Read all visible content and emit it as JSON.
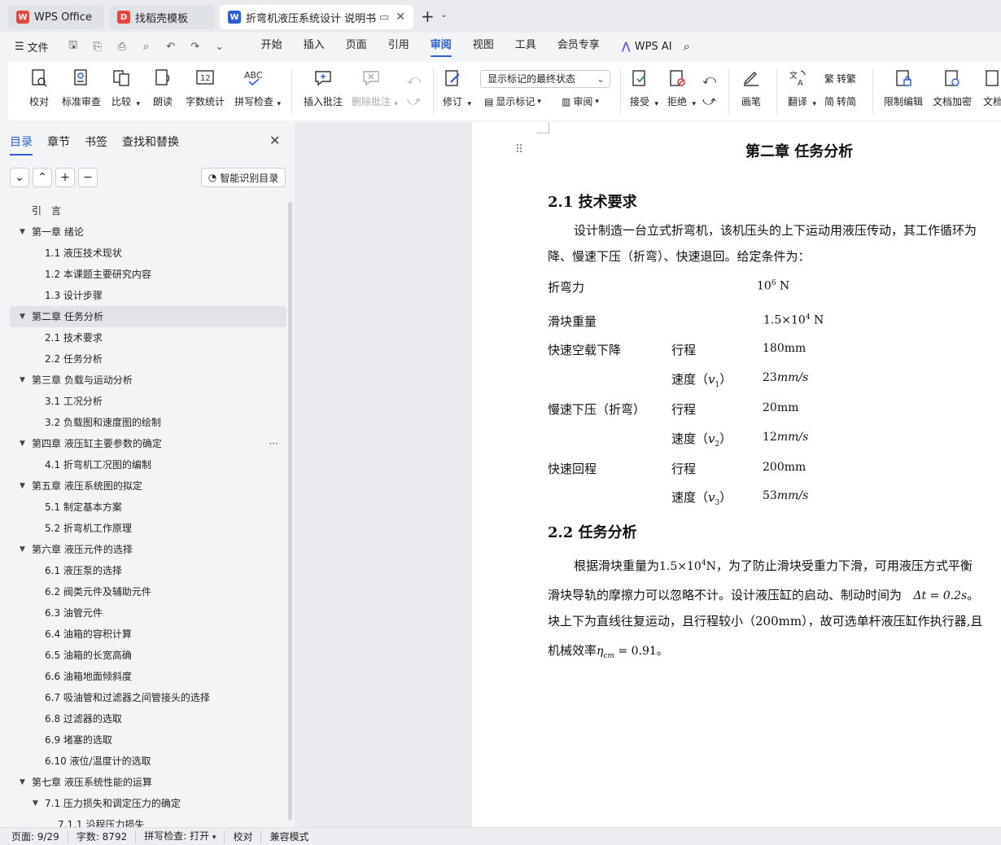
{
  "tabs": [
    {
      "label": "WPS Office",
      "icon": "wps-icon"
    },
    {
      "label": "找稻壳模板",
      "icon": "docer-icon"
    },
    {
      "label": "折弯机液压系统设计 说明书（",
      "icon": "word-doc-icon"
    }
  ],
  "menubar": {
    "file": "文件",
    "items": [
      "开始",
      "插入",
      "页面",
      "引用",
      "审阅",
      "视图",
      "工具",
      "会员专享"
    ],
    "active": "审阅",
    "ai": "WPS AI"
  },
  "ribbon": {
    "proofread": "校对",
    "standard_review": "标准审查",
    "compare": "比较",
    "read_aloud": "朗读",
    "word_count": "字数统计",
    "spell_check": "拼写检查",
    "insert_comment": "插入批注",
    "delete_comment": "删除批注",
    "revise": "修订",
    "display_state": "显示标记的最终状态",
    "show_markup": "显示标记",
    "review": "审阅",
    "accept": "接受",
    "reject": "拒绝",
    "ink": "画笔",
    "translate": "翻译",
    "to_traditional": "转繁",
    "to_simplified": "转简",
    "restrict_edit": "限制编辑",
    "encrypt": "文档加密",
    "doc_more": "文档"
  },
  "panel": {
    "tabs": [
      "目录",
      "章节",
      "书签",
      "查找和替换"
    ],
    "smart_toc": "智能识别目录",
    "toc": [
      {
        "label": "引　言",
        "level": 1,
        "tri": false
      },
      {
        "label": "第一章  绪论",
        "level": 1,
        "tri": true
      },
      {
        "label": "1.1 液压技术现状",
        "level": 2
      },
      {
        "label": "1.2 本课题主要研究内容",
        "level": 2
      },
      {
        "label": "1.3 设计步骤",
        "level": 2
      },
      {
        "label": "第二章  任务分析",
        "level": 1,
        "tri": true,
        "selected": true
      },
      {
        "label": "2.1 技术要求",
        "level": 2
      },
      {
        "label": "2.2 任务分析",
        "level": 2
      },
      {
        "label": "第三章  负载与运动分析",
        "level": 1,
        "tri": true
      },
      {
        "label": "3.1 工况分析",
        "level": 2
      },
      {
        "label": "3.2 负载图和速度图的绘制",
        "level": 2
      },
      {
        "label": "第四章  液压缸主要参数的确定",
        "level": 1,
        "tri": true,
        "more": true
      },
      {
        "label": "4.1 折弯机工况图的编制",
        "level": 2
      },
      {
        "label": "第五章  液压系统图的拟定",
        "level": 1,
        "tri": true
      },
      {
        "label": "5.1  制定基本方案",
        "level": 2
      },
      {
        "label": "5.2 折弯机工作原理",
        "level": 2
      },
      {
        "label": "第六章  液压元件的选择",
        "level": 1,
        "tri": true
      },
      {
        "label": "6.1  液压泵的选择",
        "level": 2
      },
      {
        "label": "6.2    阀类元件及辅助元件",
        "level": 2
      },
      {
        "label": "6.3  油管元件",
        "level": 2
      },
      {
        "label": "6.4 油箱的容积计算",
        "level": 2
      },
      {
        "label": "6.5 油箱的长宽高确",
        "level": 2
      },
      {
        "label": "6.6 油箱地面倾斜度",
        "level": 2
      },
      {
        "label": "6.7 吸油管和过滤器之间管接头的选择",
        "level": 2
      },
      {
        "label": "6.8 过滤器的选取",
        "level": 2
      },
      {
        "label": "6.9 堵塞的选取",
        "level": 2
      },
      {
        "label": "6.10 液位/温度计的选取",
        "level": 2
      },
      {
        "label": "第七章    液压系统性能的运算",
        "level": 1,
        "tri": true
      },
      {
        "label": "7.1    压力损失和调定压力的确定",
        "level": 2,
        "tri": true
      },
      {
        "label": "7.1.1 沿程压力损失",
        "level": 3
      }
    ]
  },
  "doc": {
    "chapter": "第二章  任务分析",
    "h21": "2.1 技术要求",
    "p1a": "设计制造一台立式折弯机，该机压头的上下运动用液压传动，其工作循环为",
    "p1b": "降、慢速下压（折弯）、快速退回。给定条件为：",
    "bend_force_label": "折弯力",
    "bend_force_base": "10",
    "bend_force_exp": "6",
    "bend_force_unit": "N",
    "slider_weight_label": "滑块重量",
    "slider_weight_val": "1.5×10",
    "slider_weight_exp": "4",
    "slider_weight_unit": "N",
    "fast_down": "快速空载下降",
    "slow_press": "慢速下压（折弯）",
    "fast_return": "快速回程",
    "stroke": "行程",
    "speed_pre": "速度（",
    "speed_post": "）",
    "v": "v",
    "sub1": "1",
    "sub2": "2",
    "sub3": "3",
    "stroke1": "180mm",
    "speed1": "23",
    "stroke2": "20mm",
    "speed2": "12",
    "stroke3": "200mm",
    "speed3": "53",
    "speed_unit": "mm/s",
    "h22": "2.2 任务分析",
    "p2a_pre": "根据滑块重量为",
    "p2a_val": "1.5×10",
    "p2a_exp": "4",
    "p2a_unit": "N",
    "p2a_post": "，为了防止滑块受重力下滑，可用液压方式平衡",
    "p2b_pre": "滑块导轨的摩擦力可以忽略不计。设计液压缸的启动、制动时间为",
    "p2b_math": "Δt = 0.2s",
    "p2b_post": "。",
    "p2c": "块上下为直线往复运动，且行程较小（200mm），故可选单杆液压缸作执行器,且",
    "p2d_pre": "机械效率",
    "p2d_eta": "η",
    "p2d_sub": "cm",
    "p2d_post": " = 0.91。"
  },
  "status": {
    "page": "页面: 9/29",
    "words": "字数: 8792",
    "spell": "拼写检查: 打开",
    "proof": "校对",
    "compat": "兼容模式"
  }
}
